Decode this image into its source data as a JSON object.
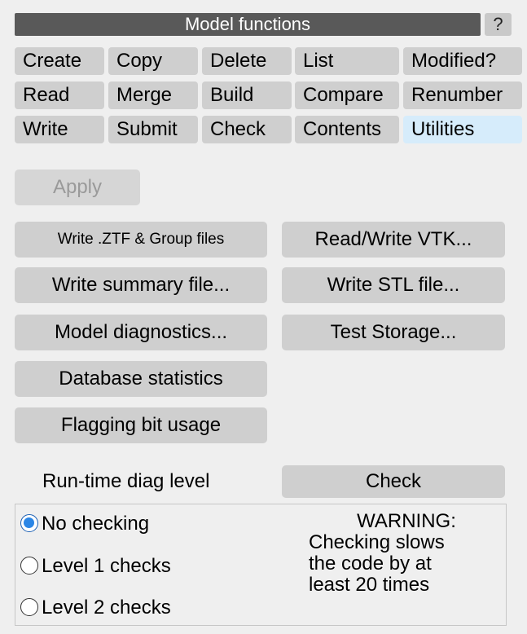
{
  "header": {
    "title": "Model functions",
    "help_label": "?"
  },
  "tabs": {
    "row1": [
      "Create",
      "Copy",
      "Delete",
      "List",
      "Modified?"
    ],
    "row2": [
      "Read",
      "Merge",
      "Build",
      "Compare",
      "Renumber"
    ],
    "row3": [
      "Write",
      "Submit",
      "Check",
      "Contents",
      "Utilities"
    ],
    "active": "Utilities"
  },
  "apply_label": "Apply",
  "utilities": {
    "write_ztf": "Write .ZTF & Group files",
    "read_write_vtk": "Read/Write VTK...",
    "write_summary": "Write summary file...",
    "write_stl": "Write STL file...",
    "model_diagnostics": "Model diagnostics...",
    "test_storage": "Test Storage...",
    "database_statistics": "Database statistics",
    "flagging_bit_usage": "Flagging bit usage"
  },
  "diag": {
    "label": "Run-time diag level",
    "check_label": "Check",
    "options": [
      "No checking",
      "Level 1 checks",
      "Level 2 checks"
    ],
    "selected": "No checking",
    "warning_title": "WARNING:",
    "warning_line1": "Checking slows",
    "warning_line2": "the code by at",
    "warning_line3": "least 20 times"
  },
  "colors": {
    "title_bg": "#595959",
    "active_tab": "#d6ecfb",
    "radio_on": "#2b86e6"
  }
}
